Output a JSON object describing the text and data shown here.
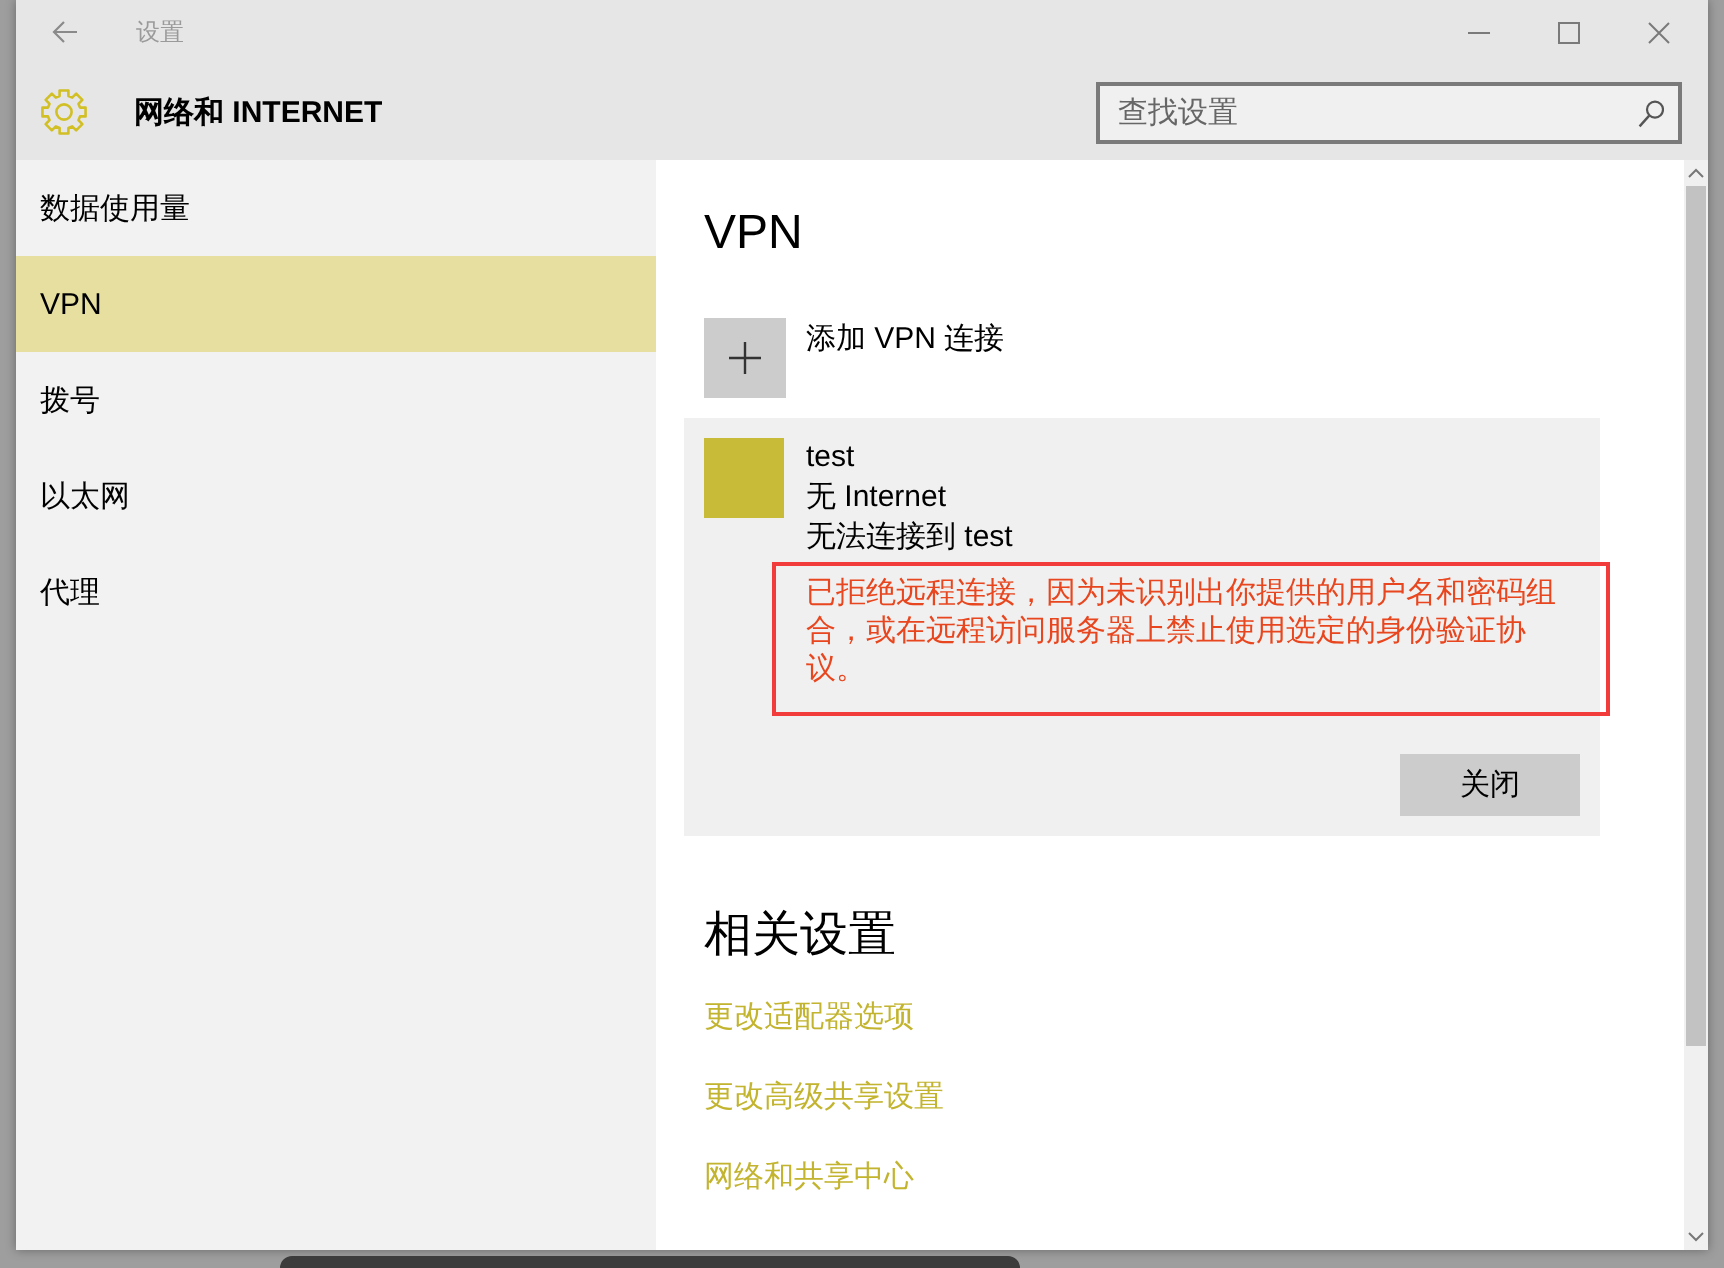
{
  "window": {
    "title": "设置"
  },
  "header": {
    "title": "网络和 INTERNET",
    "search": {
      "placeholder": "查找设置"
    }
  },
  "sidebar": {
    "items": [
      {
        "label": "数据使用量",
        "selected": false
      },
      {
        "label": "VPN",
        "selected": true
      },
      {
        "label": "拨号",
        "selected": false
      },
      {
        "label": "以太网",
        "selected": false
      },
      {
        "label": "代理",
        "selected": false
      }
    ]
  },
  "vpn": {
    "heading": "VPN",
    "add_button": {
      "label": "添加 VPN 连接"
    },
    "connections": [
      {
        "name": "test",
        "status": "无 Internet",
        "detail": "无法连接到 test",
        "error": "已拒绝远程连接，因为未识别出你提供的用户名和密码组合，或在远程访问服务器上禁止使用选定的身份验证协议。",
        "highlighted": true,
        "selected": true,
        "buttons": [
          "关闭"
        ]
      }
    ]
  },
  "related": {
    "heading": "相关设置",
    "links": [
      "更改适配器选项",
      "更改高级共享设置",
      "网络和共享中心"
    ]
  }
}
